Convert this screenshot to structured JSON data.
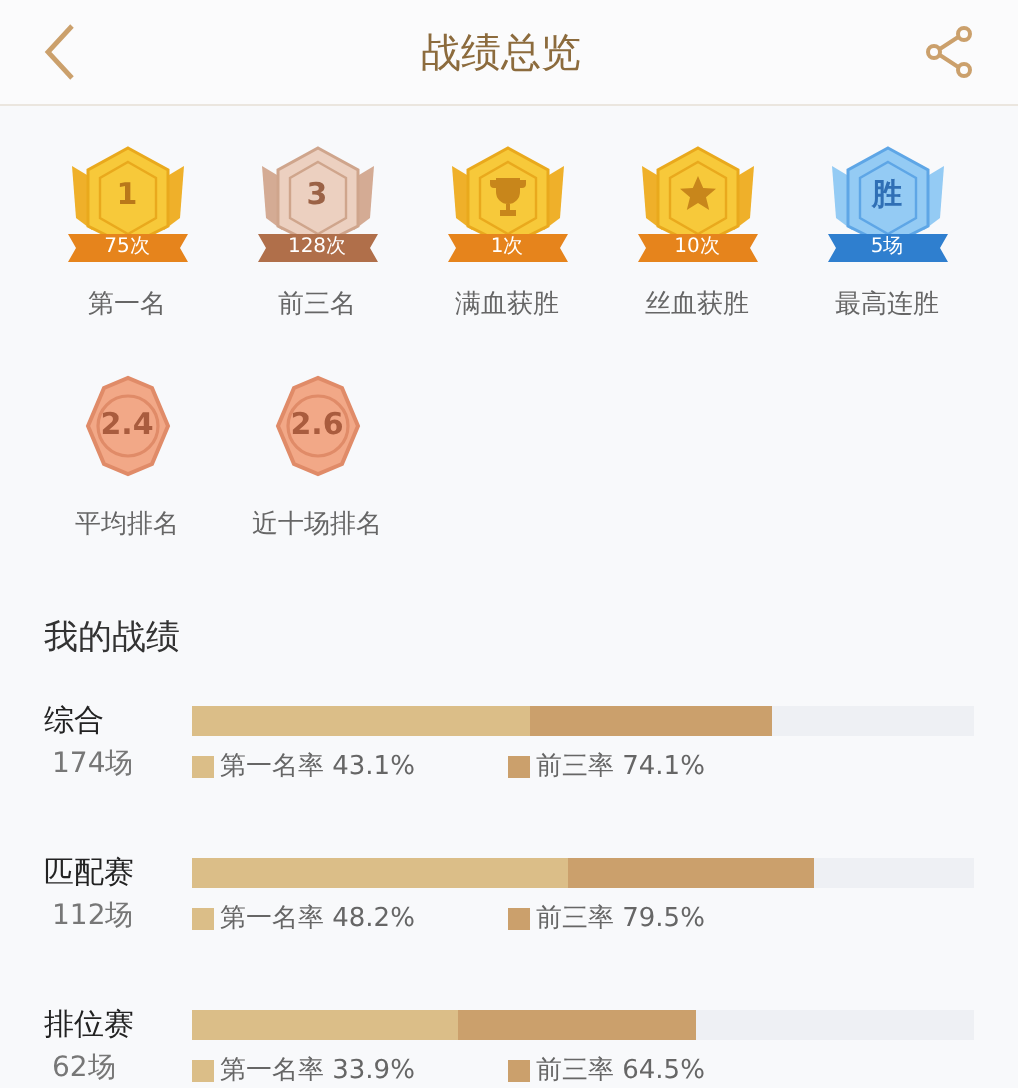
{
  "header": {
    "title": "战绩总览"
  },
  "badges": [
    {
      "kind": "gold",
      "emblem": "1",
      "count": "75次",
      "label": "第一名"
    },
    {
      "kind": "bronze",
      "emblem": "3",
      "count": "128次",
      "label": "前三名"
    },
    {
      "kind": "gold-trophy",
      "count": "1次",
      "label": "满血获胜"
    },
    {
      "kind": "gold-star",
      "count": "10次",
      "label": "丝血获胜"
    },
    {
      "kind": "blue",
      "emblem": "胜",
      "count": "5场",
      "label": "最高连胜"
    },
    {
      "kind": "rank",
      "emblem": "2.4",
      "label": "平均排名"
    },
    {
      "kind": "rank",
      "emblem": "2.6",
      "label": "近十场排名"
    }
  ],
  "stats": {
    "title": "我的战绩",
    "rows": [
      {
        "name": "综合",
        "games": "174场",
        "segments": [
          {
            "label": "第一名率 43.1%",
            "level": 0.431,
            "color": "#dbbe88"
          },
          {
            "label": "前三率 74.1%",
            "level": 0.741,
            "color": "#cba06c"
          }
        ]
      },
      {
        "name": "匹配赛",
        "games": "112场",
        "segments": [
          {
            "label": "第一名率 48.2%",
            "level": 0.482,
            "color": "#dbbe88"
          },
          {
            "label": "前三率 79.5%",
            "level": 0.795,
            "color": "#cba06c"
          }
        ]
      },
      {
        "name": "排位赛",
        "games": "62场",
        "segments": [
          {
            "label": "第一名率 33.9%",
            "level": 0.339,
            "color": "#dbbe88"
          },
          {
            "label": "前三率 64.5%",
            "level": 0.645,
            "color": "#cba06c"
          }
        ]
      }
    ]
  }
}
